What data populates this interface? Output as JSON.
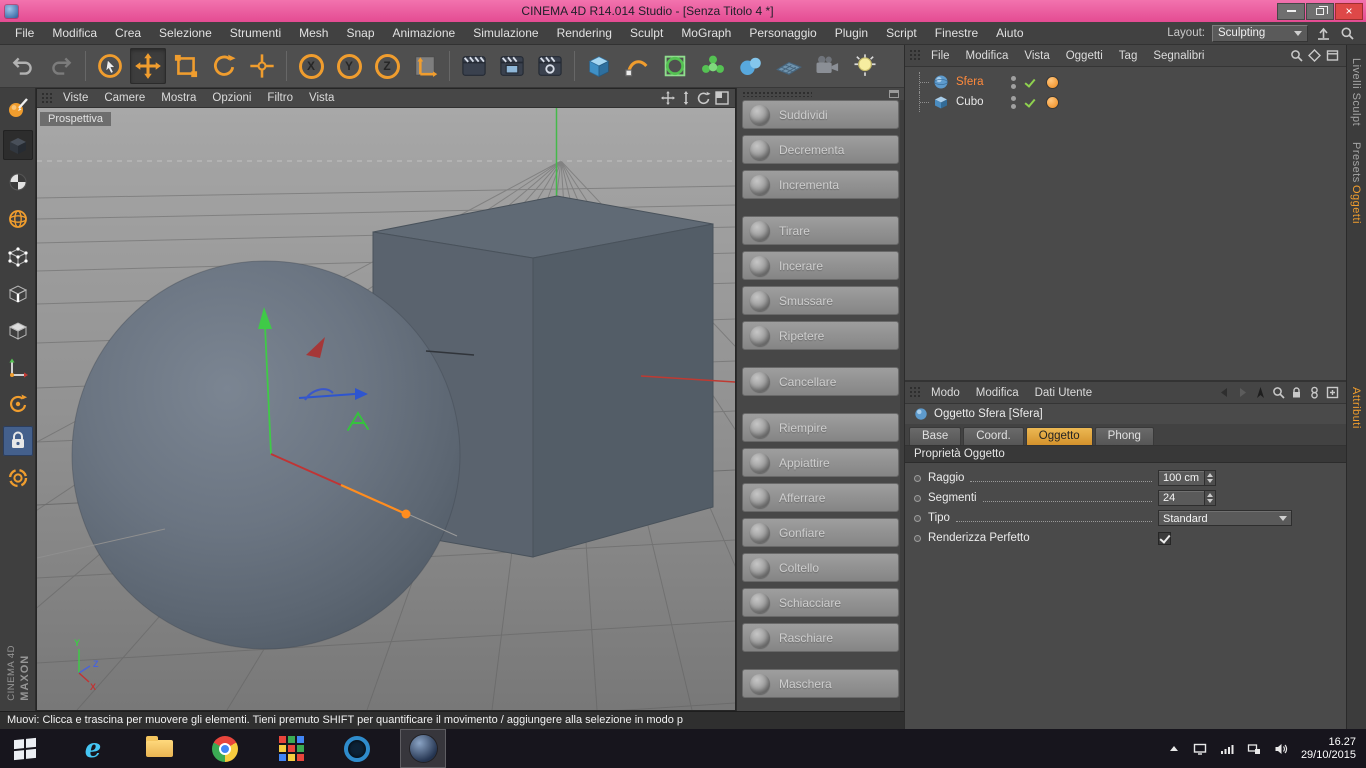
{
  "titlebar": {
    "title": "CINEMA 4D R14.014 Studio - [Senza Titolo 4 *]",
    "close_glyph": "×"
  },
  "menubar": {
    "items": [
      "File",
      "Modifica",
      "Crea",
      "Selezione",
      "Strumenti",
      "Mesh",
      "Snap",
      "Animazione",
      "Simulazione",
      "Rendering",
      "Sculpt",
      "MoGraph",
      "Personaggio",
      "Plugin",
      "Script",
      "Finestre",
      "Aiuto"
    ],
    "layout_label": "Layout:",
    "layout_value": "Sculpting"
  },
  "toolbar": {
    "axis_locks": [
      "X",
      "Y",
      "Z"
    ]
  },
  "viewport": {
    "menu": [
      "Viste",
      "Camere",
      "Mostra",
      "Opzioni",
      "Filtro",
      "Vista"
    ],
    "camera_label": "Prospettiva",
    "axis": {
      "x": "X",
      "y": "Y",
      "z": "Z"
    }
  },
  "sculpt": {
    "groups": [
      [
        "Suddividi",
        "Decrementa",
        "Incrementa"
      ],
      [
        "Tirare",
        "Incerare",
        "Smussare",
        "Ripetere"
      ],
      [
        "Cancellare"
      ],
      [
        "Riempire",
        "Appiattire",
        "Afferrare",
        "Gonfiare",
        "Coltello",
        "Schiacciare",
        "Raschiare"
      ],
      [
        "Maschera"
      ]
    ]
  },
  "object_manager": {
    "menu": [
      "File",
      "Modifica",
      "Vista",
      "Oggetti",
      "Tag",
      "Segnalibri"
    ],
    "objects": [
      {
        "name": "Sfera",
        "type": "sphere",
        "selected": true
      },
      {
        "name": "Cubo",
        "type": "cube",
        "selected": false
      }
    ]
  },
  "attribute_manager": {
    "menu": [
      "Modo",
      "Modifica",
      "Dati Utente"
    ],
    "title": "Oggetto Sfera [Sfera]",
    "tabs": [
      "Base",
      "Coord.",
      "Oggetto",
      "Phong"
    ],
    "active_tab": "Oggetto",
    "section_header": "Proprietà Oggetto",
    "fields": [
      {
        "label": "Raggio",
        "value": "100 cm",
        "type": "spinner"
      },
      {
        "label": "Segmenti",
        "value": "24",
        "type": "spinner"
      },
      {
        "label": "Tipo",
        "value": "Standard",
        "type": "dropdown"
      },
      {
        "label": "Renderizza Perfetto",
        "checked": true,
        "type": "checkbox"
      }
    ]
  },
  "side_tabs": [
    {
      "label": "Livelli Sculpt",
      "active": false
    },
    {
      "label": "Presets",
      "active": false
    },
    {
      "label": "Oggetti",
      "active": true
    },
    {
      "label": "Attributi",
      "active": true
    }
  ],
  "statusbar": {
    "text": "Muovi: Clicca e trascina per muovere gli elementi. Tieni premuto SHIFT per quantificare il movimento / aggiungere alla selezione in modo p"
  },
  "taskbar": {
    "time": "16.27",
    "date": "29/10/2015"
  },
  "branding": {
    "maxon": "MAXON",
    "cinema": "CINEMA 4D"
  },
  "colors": {
    "titlebar_pink": "#e85a9c",
    "accent_orange": "#f09d2e",
    "selected_object_text": "#ff8a3c",
    "active_tab_bg": "#d4922c"
  }
}
